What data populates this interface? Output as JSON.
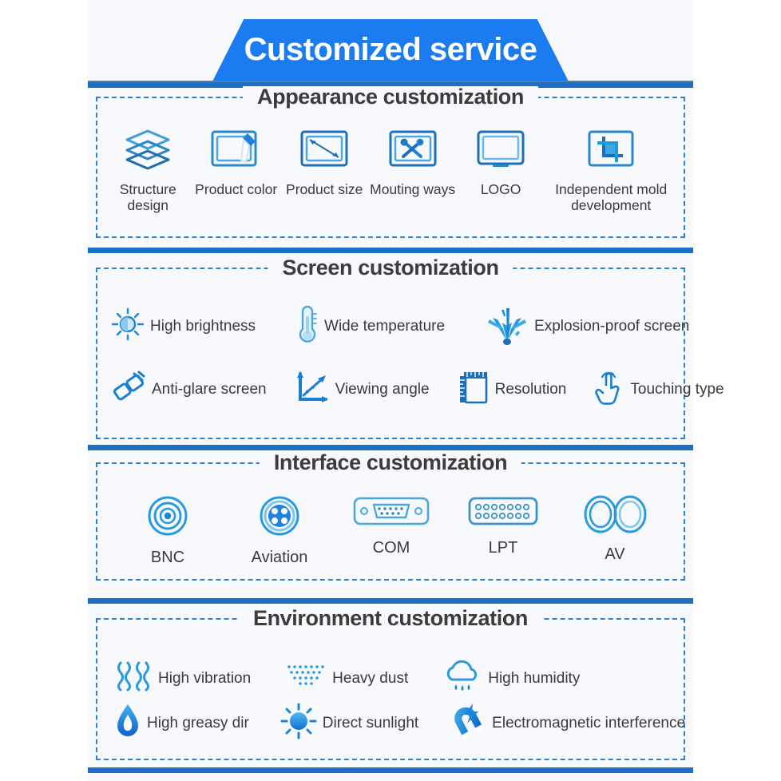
{
  "banner": {
    "title": "Customized service"
  },
  "colors": {
    "banner_blue": "#1a7cf0",
    "bar_blue": "#1b6fc4",
    "dashed_border": "#2f7fd0",
    "icon_blue": "#1b86d6",
    "icon_dark_blue": "#1f6fb8",
    "text_dark": "#3a3a3a",
    "panel_bg": "#f7f9fd"
  },
  "sections": [
    {
      "id": "appearance",
      "title": "Appearance customization",
      "layout": "single-row-6",
      "items": [
        {
          "label": "Structure design",
          "icon": "layers-icon"
        },
        {
          "label": "Product color",
          "icon": "screen-paint-icon"
        },
        {
          "label": "Product size",
          "icon": "screen-measure-icon"
        },
        {
          "label": "Mouting ways",
          "icon": "screen-tools-icon"
        },
        {
          "label": "LOGO",
          "icon": "monitor-icon"
        },
        {
          "label": "Independent mold development",
          "icon": "crop-icon"
        }
      ]
    },
    {
      "id": "screen",
      "title": "Screen customization",
      "layout": "two-rows",
      "rows": [
        [
          {
            "label": "High brightness",
            "icon": "brightness-sun-icon"
          },
          {
            "label": "Wide temperature",
            "icon": "thermometer-icon"
          },
          {
            "label": "Explosion-proof screen",
            "icon": "shatter-burst-icon"
          }
        ],
        [
          {
            "label": "Anti-glare screen",
            "icon": "anti-glare-icon"
          },
          {
            "label": "Viewing angle",
            "icon": "viewing-angle-icon"
          },
          {
            "label": "Resolution",
            "icon": "resolution-ruler-icon"
          },
          {
            "label": "Touching type",
            "icon": "touch-hand-icon"
          }
        ]
      ]
    },
    {
      "id": "interface",
      "title": "Interface customization",
      "layout": "single-row-5",
      "items": [
        {
          "label": "BNC",
          "icon": "bnc-connector-icon"
        },
        {
          "label": "Aviation",
          "icon": "aviation-connector-icon"
        },
        {
          "label": "COM",
          "icon": "com-db9-connector-icon"
        },
        {
          "label": "LPT",
          "icon": "lpt-connector-icon"
        },
        {
          "label": "AV",
          "icon": "av-connector-icon"
        }
      ]
    },
    {
      "id": "environment",
      "title": "Environment customization",
      "layout": "two-rows",
      "rows": [
        [
          {
            "label": "High vibration",
            "icon": "vibration-icon"
          },
          {
            "label": "Heavy dust",
            "icon": "dust-icon"
          },
          {
            "label": "High humidity",
            "icon": "rain-cloud-icon"
          }
        ],
        [
          {
            "label": "High greasy dir",
            "icon": "oil-drop-icon"
          },
          {
            "label": "Direct sunlight",
            "icon": "sun-icon"
          },
          {
            "label": "Electromagnetic interference",
            "icon": "magnet-bolt-icon"
          }
        ]
      ]
    }
  ]
}
